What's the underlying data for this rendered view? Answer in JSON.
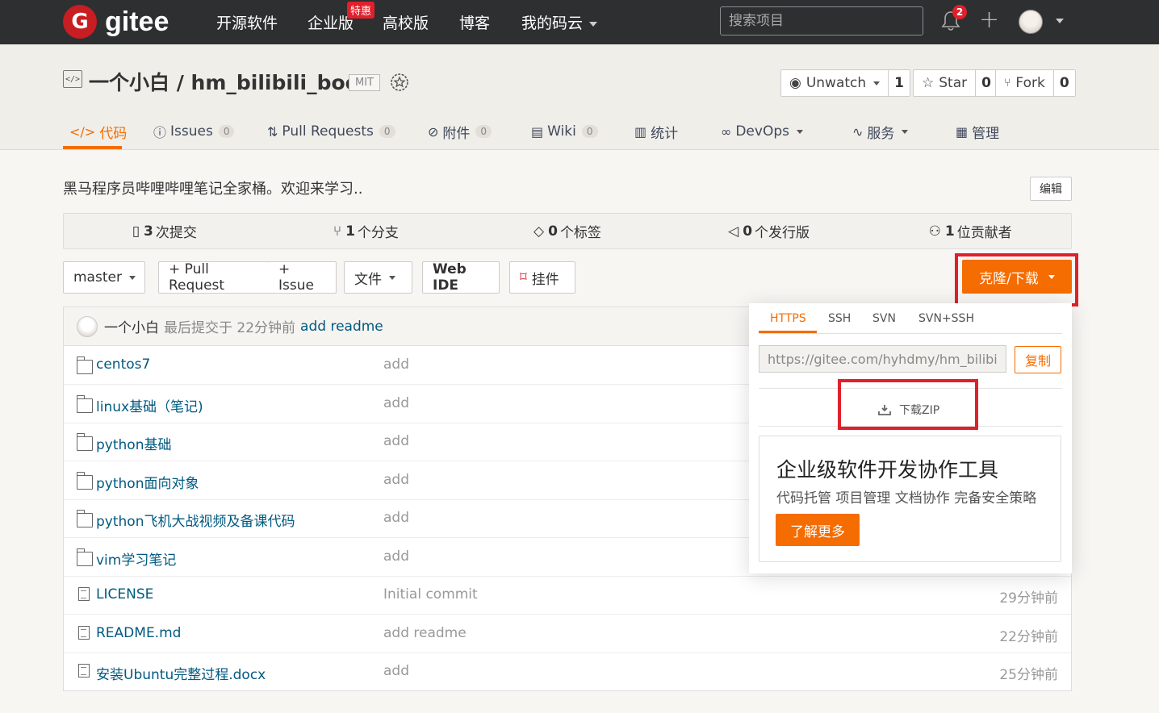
{
  "topnav": {
    "logo_mark": "G",
    "logo_text": "gitee",
    "links": [
      "开源软件",
      "企业版",
      "高校版",
      "博客",
      "我的码云"
    ],
    "hot_badge": "特惠",
    "search_placeholder": "搜索项目",
    "notification_count": "2"
  },
  "repo": {
    "title": "一个小白 / hm_bilibili_book",
    "license": "MIT",
    "watch_label": "Unwatch",
    "watch_count": "1",
    "star_label": "Star",
    "star_count": "0",
    "fork_label": "Fork",
    "fork_count": "0"
  },
  "tabs": [
    {
      "label": "代码"
    },
    {
      "label": "Issues",
      "count": "0"
    },
    {
      "label": "Pull Requests",
      "count": "0"
    },
    {
      "label": "附件",
      "count": "0"
    },
    {
      "label": "Wiki",
      "count": "0"
    },
    {
      "label": "统计"
    },
    {
      "label": "DevOps"
    },
    {
      "label": "服务"
    },
    {
      "label": "管理"
    }
  ],
  "description": "黑马程序员哔哩哔哩笔记全家桶。欢迎来学习..",
  "edit_label": "编辑",
  "stats": [
    {
      "num": "3",
      "label": "次提交"
    },
    {
      "num": "1",
      "label": "个分支"
    },
    {
      "num": "0",
      "label": "个标签"
    },
    {
      "num": "0",
      "label": "个发行版"
    },
    {
      "num": "1",
      "label": "位贡献者"
    }
  ],
  "toolbar": {
    "branch": "master",
    "pull_request": "+ Pull Request",
    "issue": "+ Issue",
    "file": "文件",
    "web_ide": "Web IDE",
    "widget": "挂件",
    "clone": "克隆/下载"
  },
  "last_commit": {
    "author": "一个小白",
    "meta": "最后提交于 22分钟前",
    "message": "add readme"
  },
  "files": [
    {
      "type": "folder",
      "name": "centos7",
      "commit": "add",
      "time": ""
    },
    {
      "type": "folder",
      "name": "linux基础（笔记)",
      "commit": "add",
      "time": ""
    },
    {
      "type": "folder",
      "name": "python基础",
      "commit": "add",
      "time": ""
    },
    {
      "type": "folder",
      "name": "python面向对象",
      "commit": "add",
      "time": ""
    },
    {
      "type": "folder",
      "name": "python飞机大战视频及备课代码",
      "commit": "add",
      "time": ""
    },
    {
      "type": "folder",
      "name": "vim学习笔记",
      "commit": "add",
      "time": ""
    },
    {
      "type": "file",
      "name": "LICENSE",
      "commit": "Initial commit",
      "time": "29分钟前"
    },
    {
      "type": "file",
      "name": "README.md",
      "commit": "add readme",
      "time": "22分钟前"
    },
    {
      "type": "file",
      "name": "安装Ubuntu完整过程.docx",
      "commit": "add",
      "time": "25分钟前"
    }
  ],
  "clone_dropdown": {
    "tabs": [
      "HTTPS",
      "SSH",
      "SVN",
      "SVN+SSH"
    ],
    "url": "https://gitee.com/hyhdmy/hm_bilibili_",
    "copy": "复制",
    "download_zip": "下载ZIP",
    "promo_title": "企业级软件开发协作工具",
    "promo_sub": "代码托管 项目管理 文档协作 完备安全策略",
    "promo_btn": "了解更多"
  },
  "colors": {
    "accent": "#f56c00",
    "nav_bg": "#2e2f31",
    "brand_red": "#c71d23",
    "highlight_red": "#e0202b",
    "link": "#005980"
  }
}
